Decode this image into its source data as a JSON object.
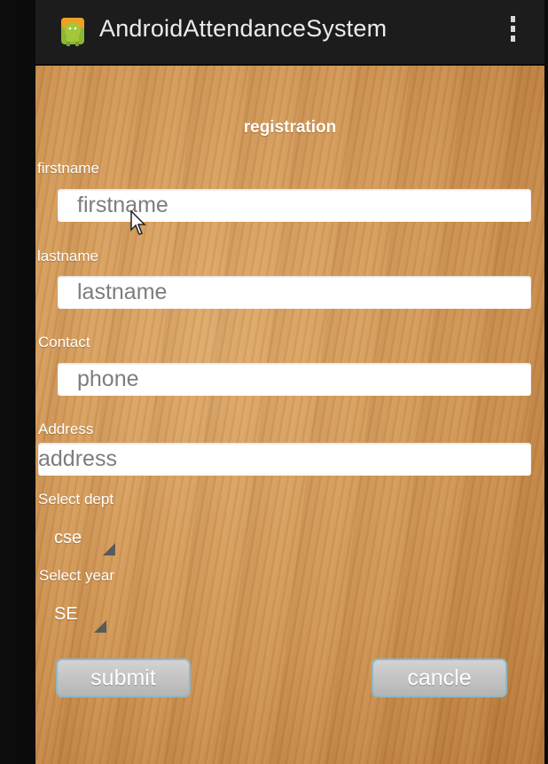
{
  "app": {
    "title": "AndroidAttendanceSystem",
    "icon": "android-icon",
    "overflow_icon": "overflow-menu-icon"
  },
  "form": {
    "heading": "registration",
    "firstname": {
      "label": "firstname",
      "placeholder": "firstname"
    },
    "lastname": {
      "label": "lastname",
      "placeholder": "lastname"
    },
    "contact": {
      "label": "Contact",
      "placeholder": "phone"
    },
    "address": {
      "label": "Address",
      "placeholder": "address"
    },
    "dept": {
      "label": "Select dept",
      "value": "cse"
    },
    "year": {
      "label": "Select year",
      "value": "SE"
    }
  },
  "buttons": {
    "submit": "submit",
    "cancel": "cancle"
  },
  "colors": {
    "action_bar": "#1c1c1c",
    "wood_background": "#cf9453",
    "android_green": "#a4c639",
    "button_border": "#8fb7c7"
  }
}
